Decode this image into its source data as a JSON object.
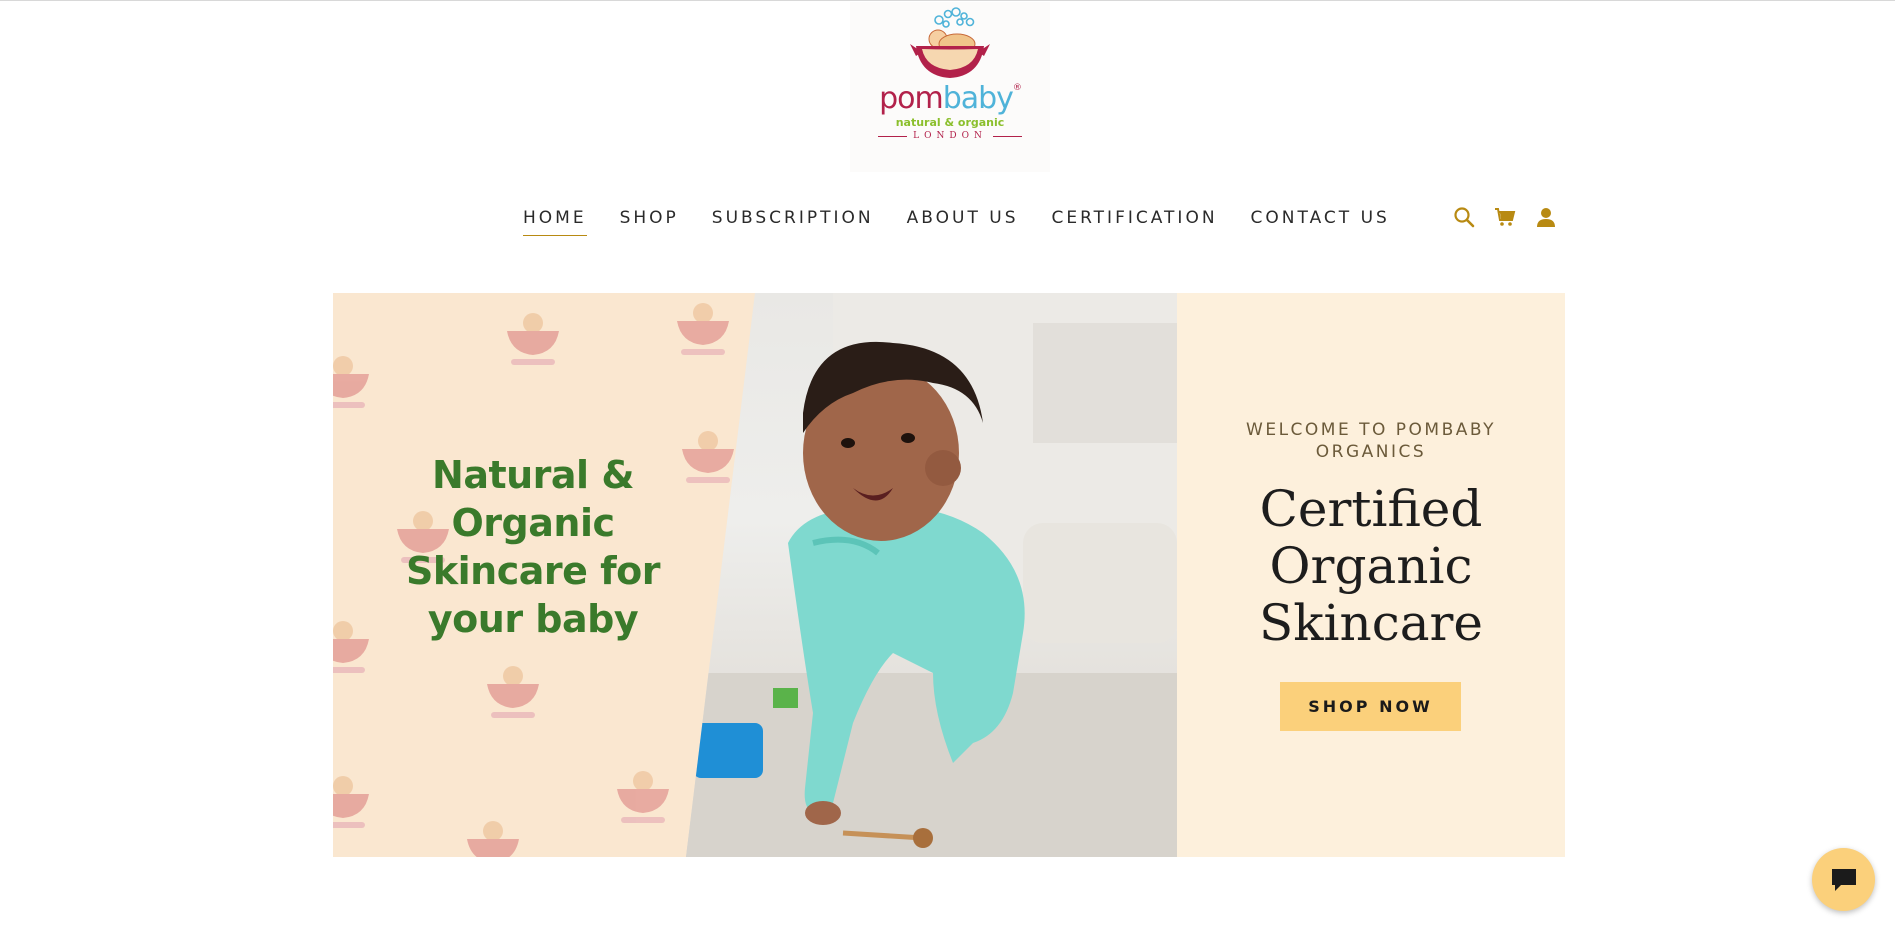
{
  "logo": {
    "brand_pom": "pom",
    "brand_baby": "baby",
    "registered": "®",
    "tagline": "natural & organic",
    "city": "LONDON"
  },
  "nav": {
    "items": [
      {
        "label": "HOME",
        "active": true
      },
      {
        "label": "SHOP"
      },
      {
        "label": "SUBSCRIPTION"
      },
      {
        "label": "ABOUT US"
      },
      {
        "label": "CERTIFICATION"
      },
      {
        "label": "CONTACT US"
      }
    ],
    "icons": [
      "search-icon",
      "cart-icon",
      "account-icon"
    ],
    "accent_color": "#b88a12"
  },
  "hero": {
    "image_headline": "Natural & Organic Skincare for your baby",
    "welcome": "WELCOME TO POMBABY ORGANICS",
    "title": "Certified Organic Skincare",
    "cta_label": "SHOP NOW",
    "cta_color": "#fbd07b",
    "panel_color": "#fdf0dc"
  },
  "chat": {
    "icon": "chat-bubble-icon"
  }
}
